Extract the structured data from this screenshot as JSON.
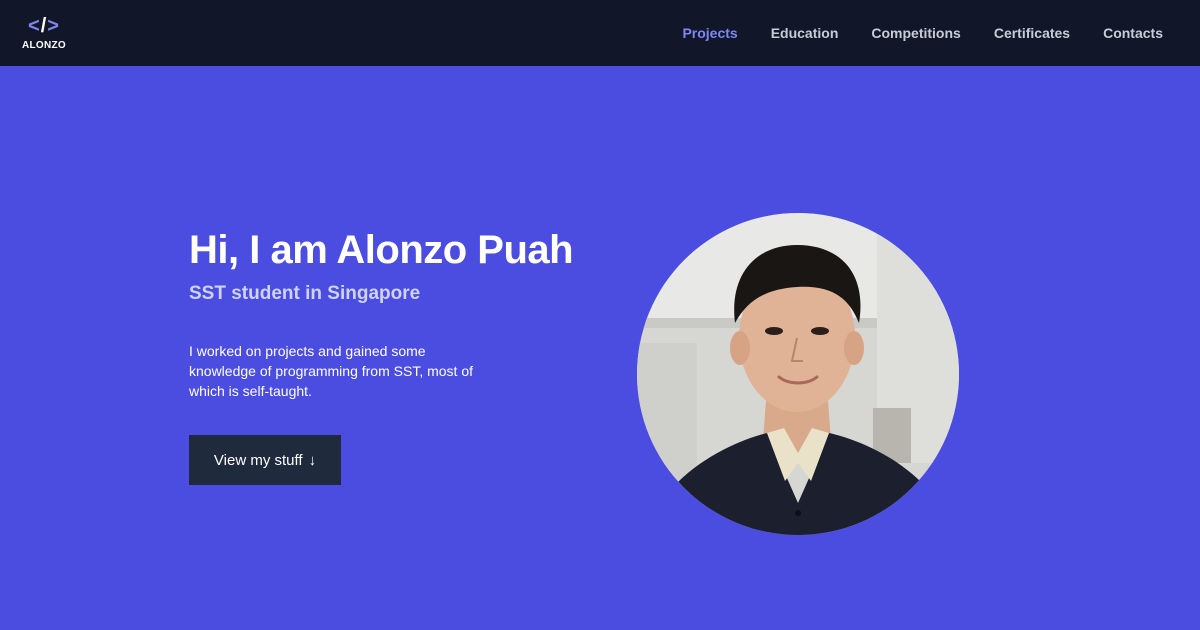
{
  "brand": {
    "logo_symbol_open": "<",
    "logo_symbol_slash": "/",
    "logo_symbol_close": ">",
    "logo_text": "ALONZO",
    "accent_color": "#7f86f5",
    "nav_background": "#111729",
    "hero_background": "#4a4ddf"
  },
  "nav": {
    "items": [
      {
        "label": "Projects",
        "active": true
      },
      {
        "label": "Education",
        "active": false
      },
      {
        "label": "Competitions",
        "active": false
      },
      {
        "label": "Certificates",
        "active": false
      },
      {
        "label": "Contacts",
        "active": false
      }
    ]
  },
  "hero": {
    "title": "Hi, I am Alonzo Puah",
    "subtitle": "SST student in Singapore",
    "description": "I worked on projects and gained some knowledge of programming from SST, most of which is self-taught.",
    "cta_label": "View my stuff",
    "cta_icon": "arrow-down-icon",
    "cta_icon_glyph": "↓"
  }
}
